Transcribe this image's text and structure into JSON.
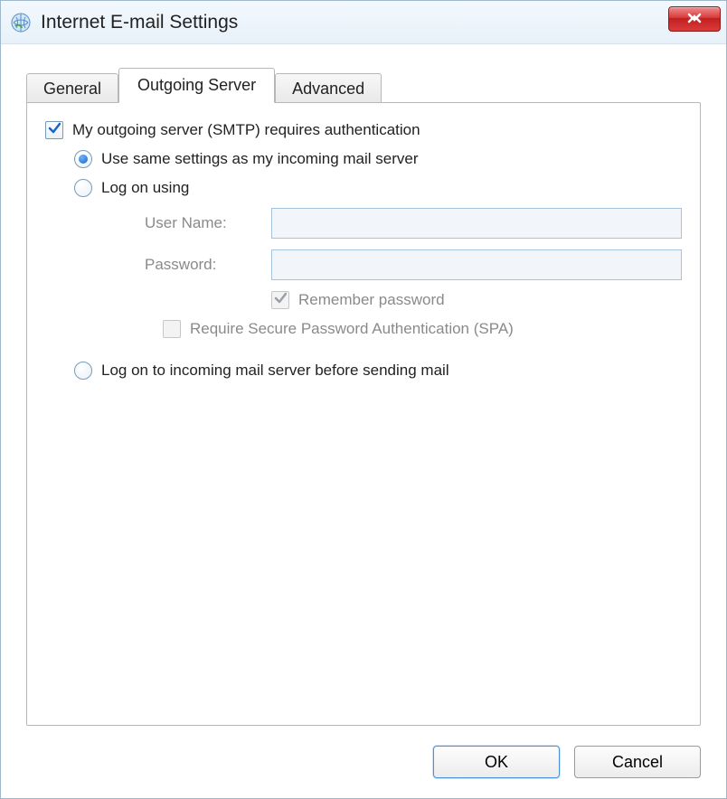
{
  "window": {
    "title": "Internet E-mail Settings"
  },
  "tabs": {
    "general": "General",
    "outgoing": "Outgoing Server",
    "advanced": "Advanced"
  },
  "form": {
    "requires_auth_label": "My outgoing server (SMTP) requires authentication",
    "use_same_label": "Use same settings as my incoming mail server",
    "logon_using_label": "Log on using",
    "username_label": "User Name:",
    "password_label": "Password:",
    "username_value": "",
    "password_value": "",
    "remember_password_label": "Remember password",
    "require_spa_label": "Require Secure Password Authentication (SPA)",
    "logon_incoming_label": "Log on to incoming mail server before sending mail"
  },
  "buttons": {
    "ok": "OK",
    "cancel": "Cancel"
  }
}
